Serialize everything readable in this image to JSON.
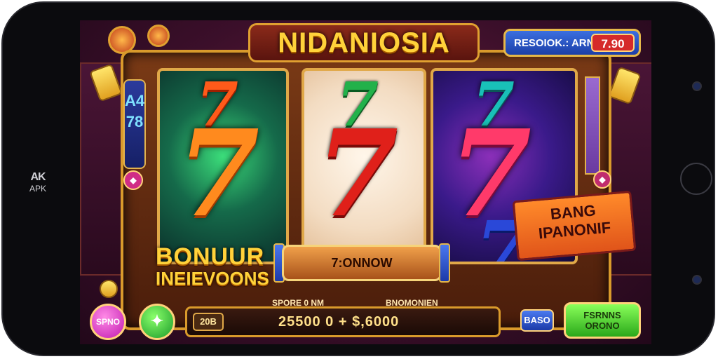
{
  "device": {
    "logo_top": "AK",
    "logo_bottom": "APK"
  },
  "game": {
    "title": "NIDANIOSIA",
    "top_badge": {
      "label": "RESOIOK.: ARN",
      "value": "7.90"
    },
    "left_tab": {
      "line1": "A4",
      "line2": "78"
    },
    "bonus_text": {
      "line1": "BONUUR",
      "line2": "INEIEVOONS"
    },
    "promo_banner": {
      "line1": "BANG",
      "line2": "IPANONIF"
    },
    "spin_plate": "7:ONNOW",
    "bar": {
      "left_box": "20B",
      "label_left": "SPORE 0 NM",
      "label_right": "BNOMONIEN",
      "value": "25500 0 + $,6000"
    },
    "buttons": {
      "pink": "SPNO",
      "green": "✦",
      "blue": "BASO",
      "spin_line1": "FSRNNS",
      "spin_line2": "ORONO"
    },
    "reels": [
      {
        "symbols": [
          "7",
          "7"
        ]
      },
      {
        "symbols": [
          "7",
          "7"
        ]
      },
      {
        "symbols": [
          "7",
          "7",
          "7"
        ]
      }
    ],
    "colors": {
      "title_gold": "#ffd23a",
      "frame_gold": "#d99a2b",
      "badge_blue": "#1c3fa8",
      "value_red": "#d52a2a"
    }
  }
}
